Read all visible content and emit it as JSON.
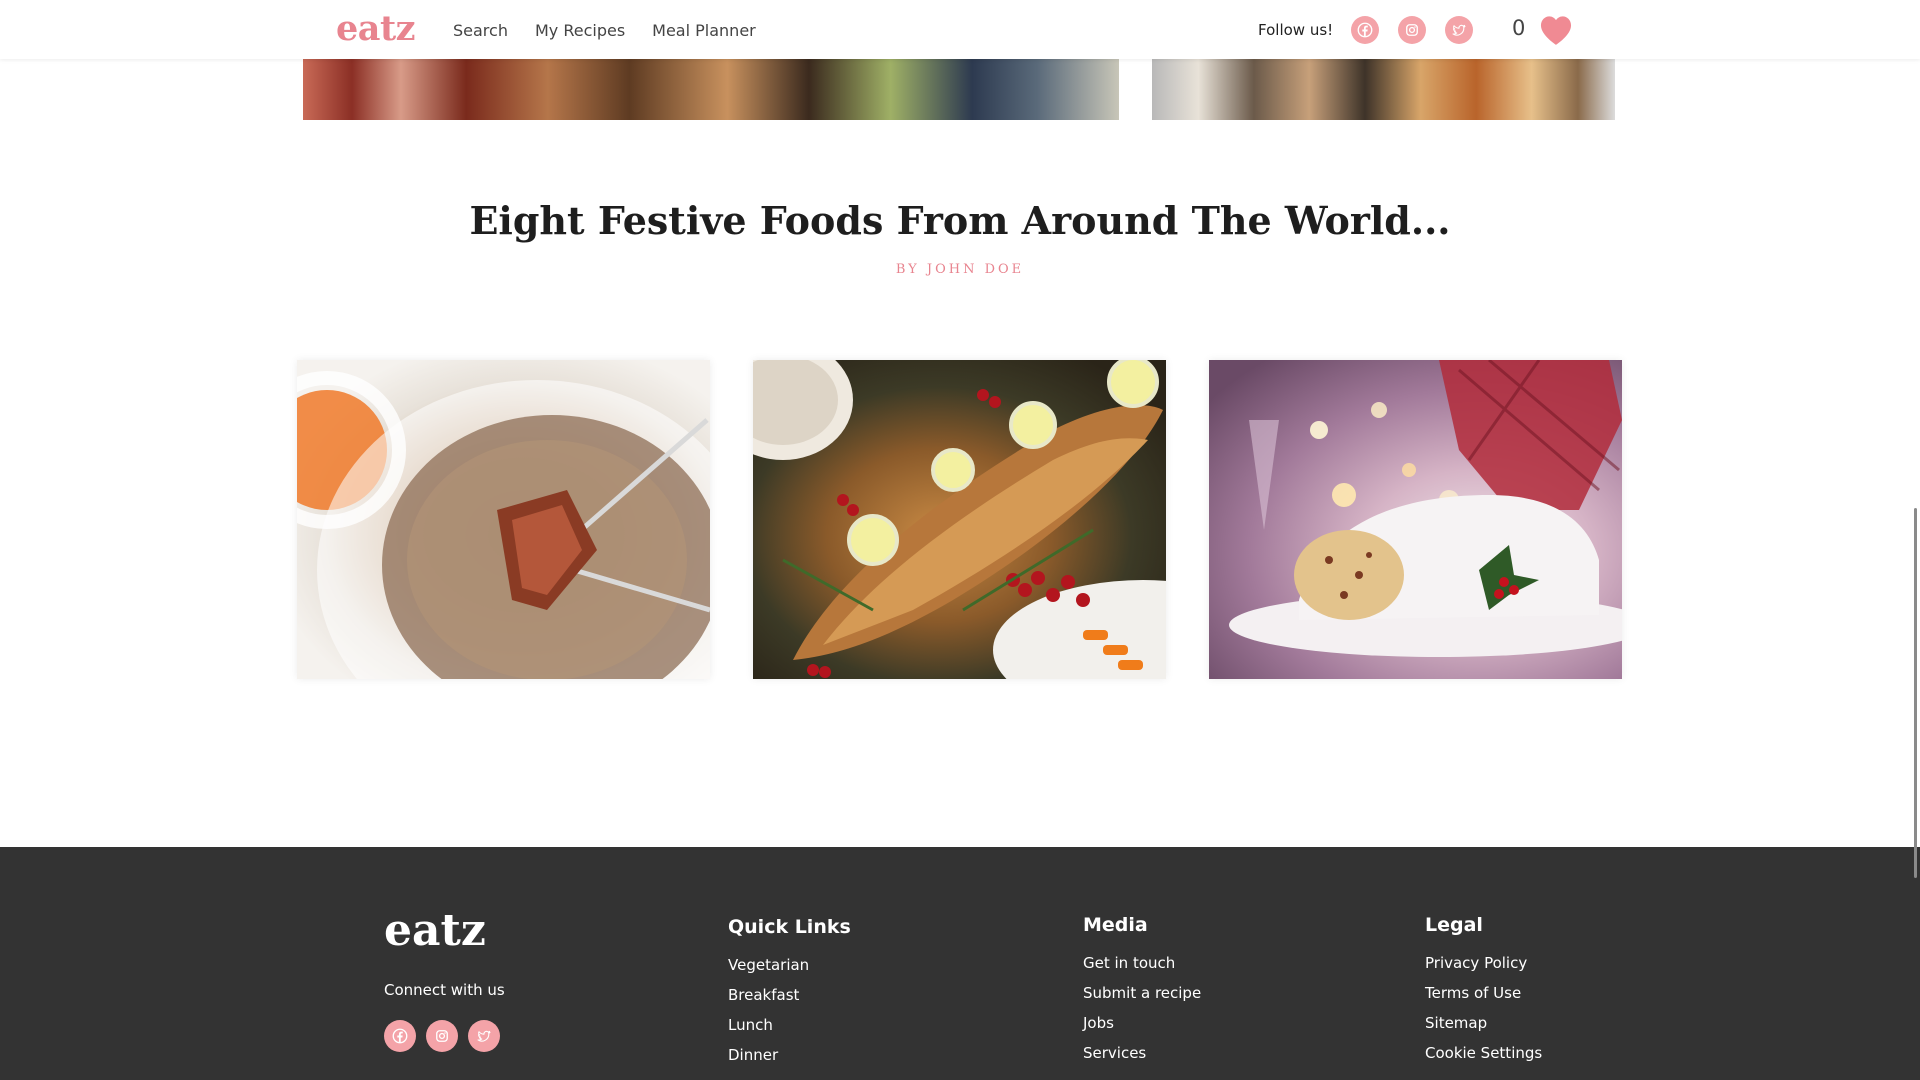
{
  "header": {
    "logo": "eatz",
    "nav": [
      "Search",
      "My Recipes",
      "Meal Planner"
    ],
    "follow_label": "Follow us!",
    "social_icons": [
      "facebook-icon",
      "instagram-icon",
      "twitter-icon"
    ],
    "favorites_count": "0"
  },
  "article": {
    "title": "Eight Festive Foods From Around The World...",
    "byline": "BY JOHN DOE"
  },
  "gallery": {
    "images": [
      "fondue-image",
      "roast-fish-image",
      "stollen-image"
    ]
  },
  "footer": {
    "logo": "eatz",
    "connect_label": "Connect with us",
    "quick_links": {
      "heading": "Quick Links",
      "items": [
        "Vegetarian",
        "Breakfast",
        "Lunch",
        "Dinner"
      ]
    },
    "media": {
      "heading": "Media",
      "items": [
        "Get in touch",
        "Submit a recipe",
        "Jobs",
        "Services"
      ]
    },
    "legal": {
      "heading": "Legal",
      "items": [
        "Privacy Policy",
        "Terms of Use",
        "Sitemap",
        "Cookie Settings"
      ]
    }
  },
  "colors": {
    "accent": "#e8848f",
    "social_bg": "#f4a3a8",
    "footer_bg": "#333333"
  }
}
